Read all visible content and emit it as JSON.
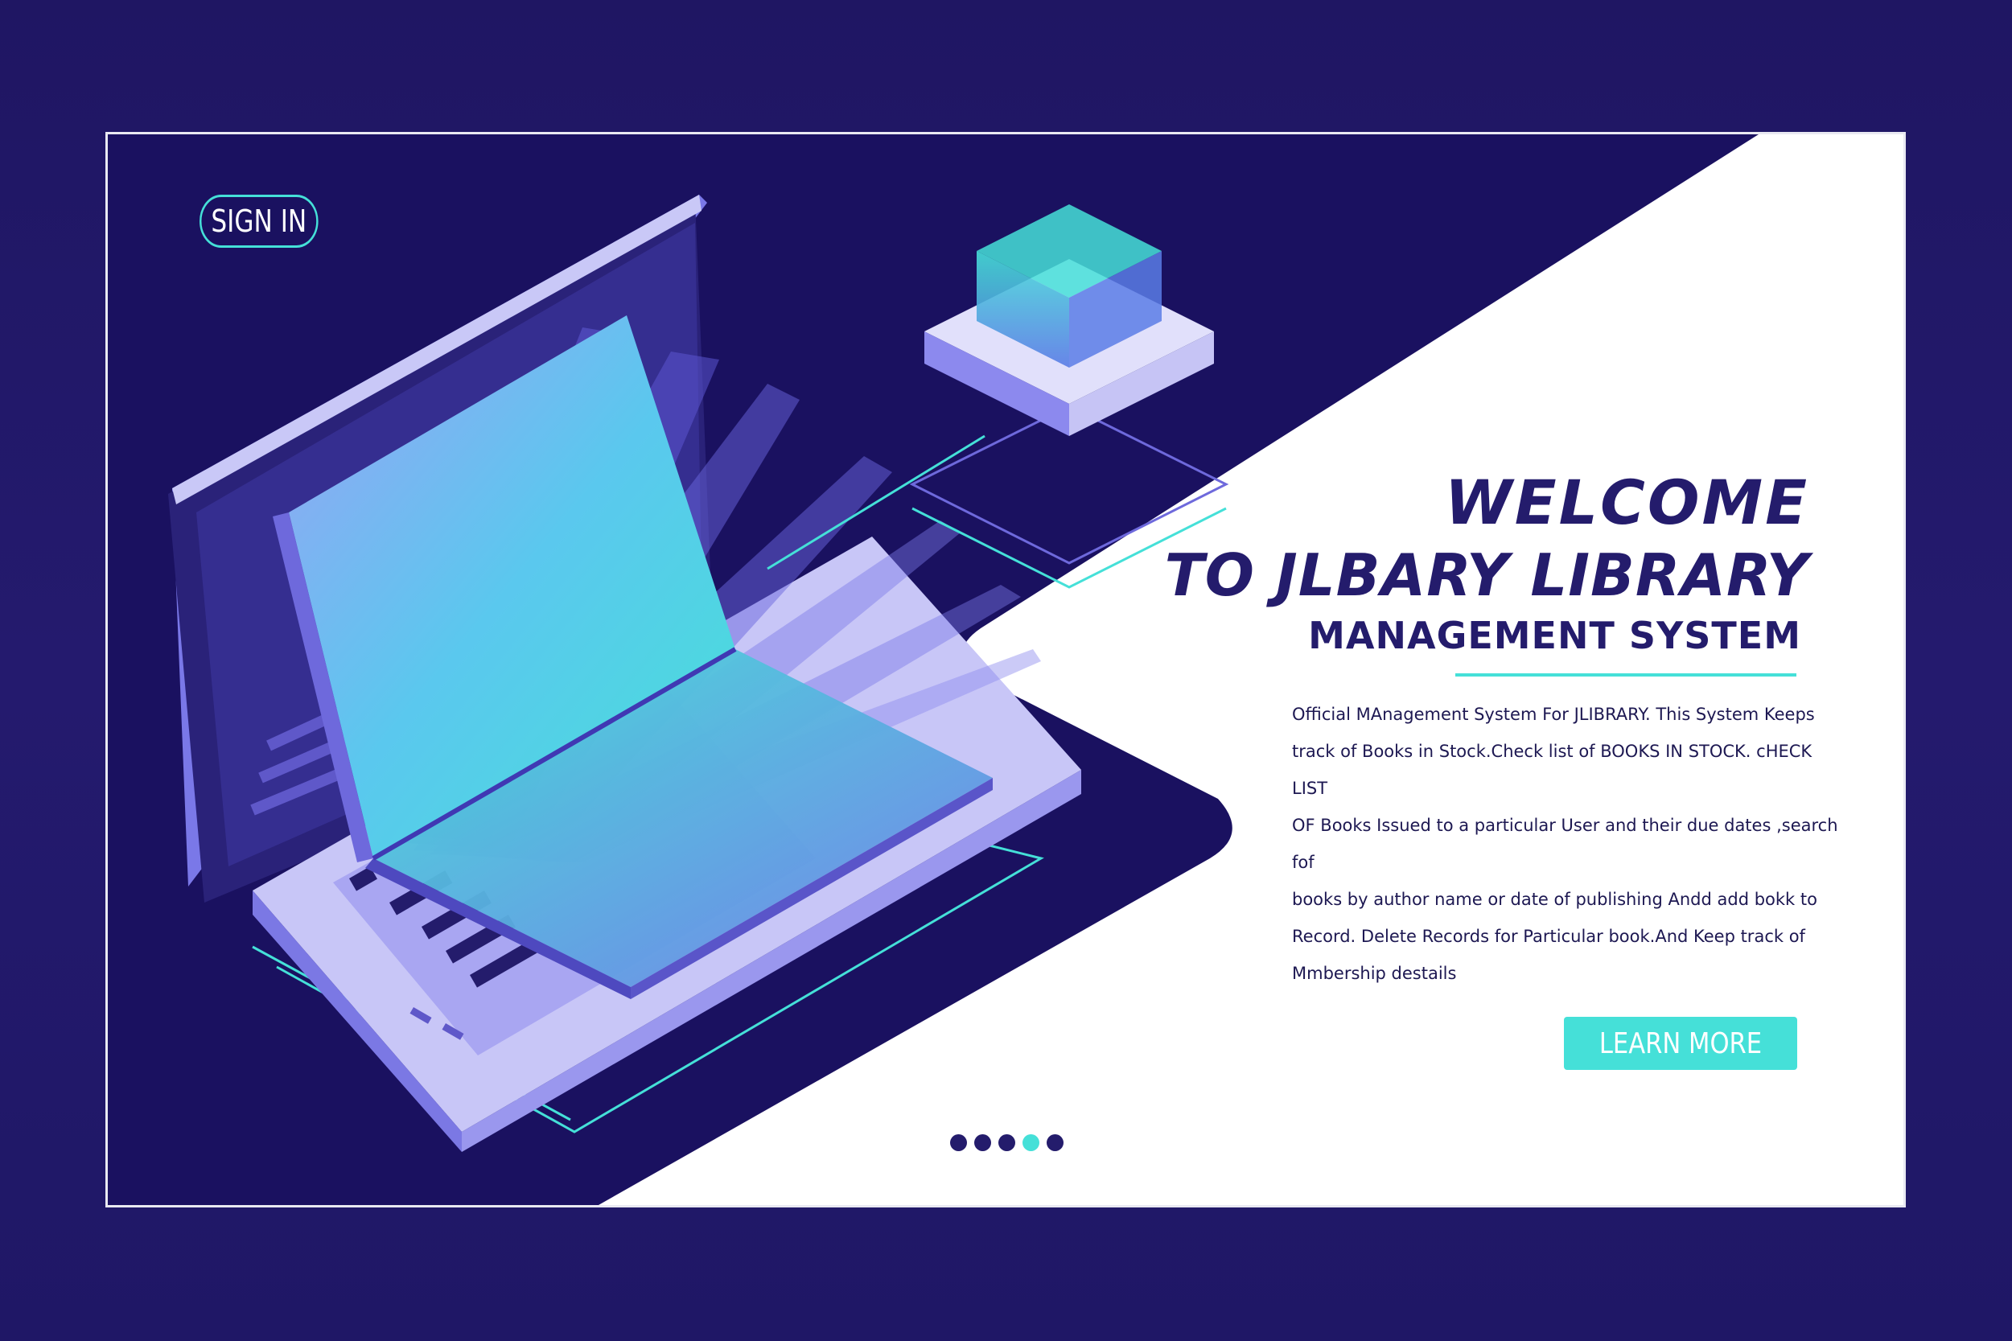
{
  "header": {
    "signin_label": "SIGN IN"
  },
  "hero": {
    "title_line1": "WELCOME",
    "title_line2": "TO JLBARY LIBRARY",
    "title_line3": "MANAGEMENT SYSTEM",
    "description": "Official MAnagement System For JLIBRARY.  This System Keeps\ntrack of Books in Stock.Check  list of BOOKS IN STOCK. cHECK LIST\nOF Books Issued to a particular User and their due dates ,search fof\nbooks by author name or date of publishing Andd add bokk to\nRecord. Delete Records for Particular book.And Keep track of\nMmbership destails",
    "learn_more_label": "LEARN MORE"
  },
  "carousel": {
    "slide_count": 5,
    "active_index": 3
  },
  "icons": {
    "illustration": "laptop-open-book-illustration",
    "cube": "database-cube-icon"
  },
  "colors": {
    "background": "#221a66",
    "panel_dark": "#1a1160",
    "accent": "#45e0d8",
    "text_dark": "#241c6c",
    "panel_light": "#ffffff"
  }
}
